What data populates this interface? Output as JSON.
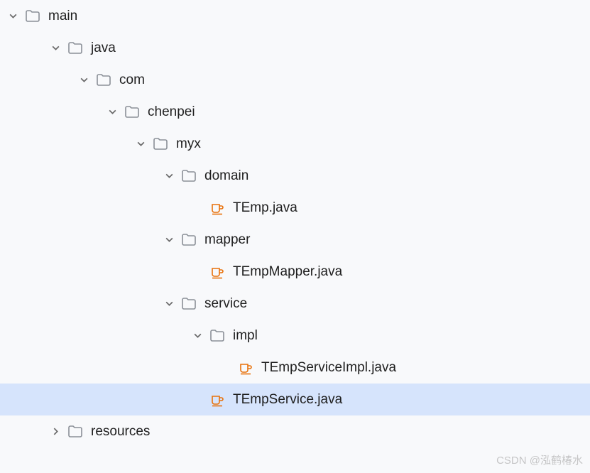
{
  "tree": {
    "n0": {
      "label": "main"
    },
    "n1": {
      "label": "java"
    },
    "n2": {
      "label": "com"
    },
    "n3": {
      "label": "chenpei"
    },
    "n4": {
      "label": "myx"
    },
    "n5": {
      "label": "domain"
    },
    "n6": {
      "label": "TEmp.java"
    },
    "n7": {
      "label": "mapper"
    },
    "n8": {
      "label": "TEmpMapper.java"
    },
    "n9": {
      "label": "service"
    },
    "n10": {
      "label": "impl"
    },
    "n11": {
      "label": "TEmpServiceImpl.java"
    },
    "n12": {
      "label": "TEmpService.java"
    },
    "n13": {
      "label": "resources"
    }
  },
  "watermark": "CSDN @泓鹤椿水"
}
